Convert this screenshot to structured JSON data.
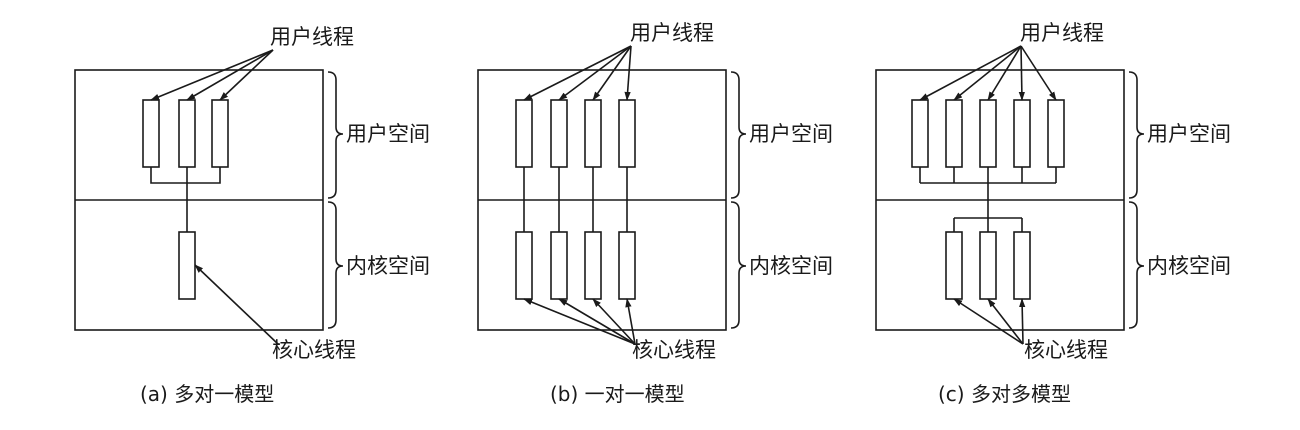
{
  "diagrams": [
    {
      "caption": "(a) 多对一模型",
      "user_threads_label": "用户线程",
      "kernel_threads_label": "核心线程",
      "user_space_label": "用户空间",
      "kernel_space_label": "内核空间"
    },
    {
      "caption": "(b) 一对一模型",
      "user_threads_label": "用户线程",
      "kernel_threads_label": "核心线程",
      "user_space_label": "用户空间",
      "kernel_space_label": "内核空间"
    },
    {
      "caption": "(c) 多对多模型",
      "user_threads_label": "用户线程",
      "kernel_threads_label": "核心线程",
      "user_space_label": "用户空间",
      "kernel_space_label": "内核空间"
    }
  ],
  "stroke_color": "#1a1a1a"
}
